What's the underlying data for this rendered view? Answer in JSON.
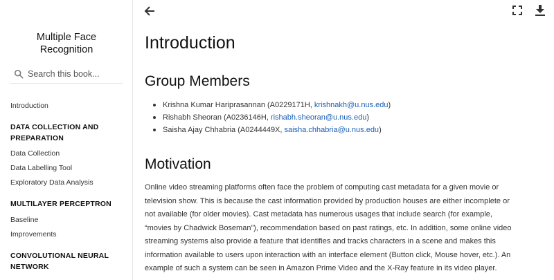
{
  "book": {
    "title": "Multiple Face Recognition"
  },
  "search": {
    "placeholder": "Search this book..."
  },
  "nav": {
    "intro": "Introduction",
    "section1": "DATA COLLECTION AND PREPARATION",
    "data_collection": "Data Collection",
    "data_labelling": "Data Labelling Tool",
    "eda": "Exploratory Data Analysis",
    "section2": "MULTILAYER PERCEPTRON",
    "baseline": "Baseline",
    "improvements": "Improvements",
    "section3": "CONVOLUTIONAL NEURAL NETWORK"
  },
  "toolbar": {
    "back_icon": "arrow-left-icon",
    "fullscreen_icon": "fullscreen-icon",
    "download_icon": "download-icon"
  },
  "page": {
    "title": "Introduction",
    "group_heading": "Group Members",
    "members": [
      {
        "name": "Krishna Kumar Hariprasannan (A0229171H, ",
        "email": "krishnakh@u.nus.edu",
        "close": ")"
      },
      {
        "name": "Rishabh Sheoran (A0236146H, ",
        "email": "rishabh.sheoran@u.nus.edu",
        "close": ")"
      },
      {
        "name": "Saisha Ajay Chhabria (A0244449X, ",
        "email": "saisha.chhabria@u.nus.edu",
        "close": ")"
      }
    ],
    "motivation_heading": "Motivation",
    "motivation_text": "Online video streaming platforms often face the problem of computing cast metadata for a given movie or television show. This is because the cast information provided by production houses are either incomplete or not available (for older movies). Cast metadata has numerous usages that include search (for example, “movies by Chadwick Boseman”), recommendation based on past ratings, etc. In addition, some online video streaming systems also provide a feature that identifies and tracks characters in a scene and makes this information available to users upon interaction with an interface element (Button click, Mouse hover, etc.). An example of such a system can be seen in Amazon Prime Video and the X-Ray feature in its video player."
  },
  "colors": {
    "link": "#1a5fb4",
    "border": "#e6e6e6"
  }
}
